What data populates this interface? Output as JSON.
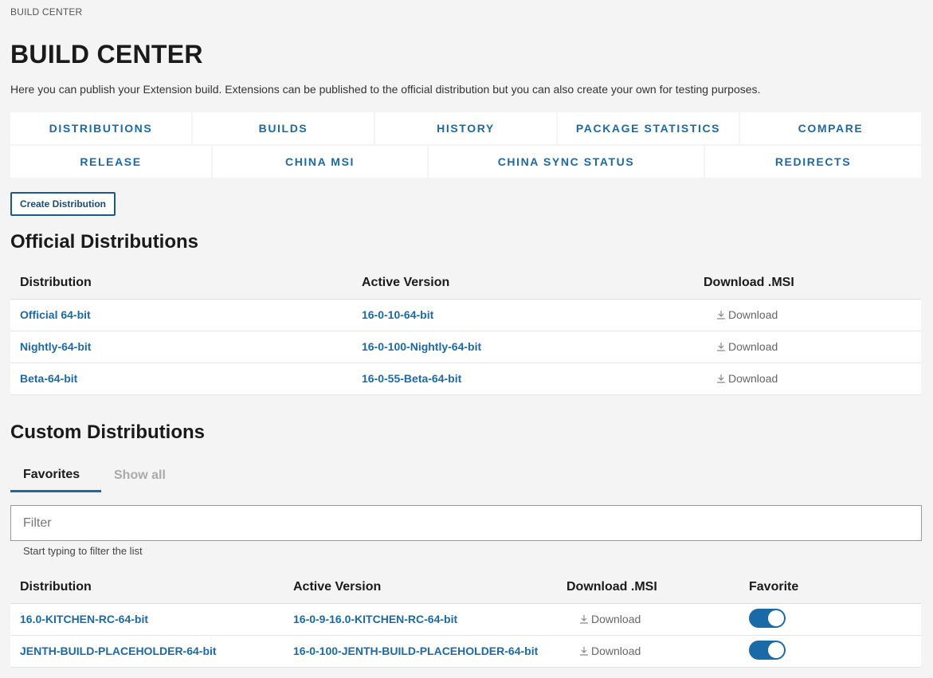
{
  "breadcrumb": "BUILD CENTER",
  "title": "BUILD CENTER",
  "intro": "Here you can publish your Extension build. Extensions can be published to the official distribution but you can also create your own for testing purposes.",
  "nav_row1": [
    "DISTRIBUTIONS",
    "BUILDS",
    "HISTORY",
    "PACKAGE STATISTICS",
    "COMPARE"
  ],
  "nav_row2": [
    "RELEASE",
    "CHINA MSI",
    "CHINA SYNC STATUS",
    "REDIRECTS"
  ],
  "create_button": "Create Distribution",
  "official": {
    "title": "Official Distributions",
    "headers": [
      "Distribution",
      "Active Version",
      "Download .MSI"
    ],
    "rows": [
      {
        "distribution": "Official 64-bit",
        "version": "16-0-10-64-bit",
        "download": "Download"
      },
      {
        "distribution": "Nightly-64-bit",
        "version": "16-0-100-Nightly-64-bit",
        "download": "Download"
      },
      {
        "distribution": "Beta-64-bit",
        "version": "16-0-55-Beta-64-bit",
        "download": "Download"
      }
    ]
  },
  "custom": {
    "title": "Custom Distributions",
    "tabs": [
      "Favorites",
      "Show all"
    ],
    "filter_placeholder": "Filter",
    "filter_help": "Start typing to filter the list",
    "headers": [
      "Distribution",
      "Active Version",
      "Download .MSI",
      "Favorite"
    ],
    "rows": [
      {
        "distribution": "16.0-KITCHEN-RC-64-bit",
        "version": "16-0-9-16.0-KITCHEN-RC-64-bit",
        "download": "Download",
        "favorite": true
      },
      {
        "distribution": "JENTH-BUILD-PLACEHOLDER-64-bit",
        "version": "16-0-100-JENTH-BUILD-PLACEHOLDER-64-bit",
        "download": "Download",
        "favorite": true
      }
    ]
  },
  "colors": {
    "accent": "#1a6aa8",
    "background": "#f4f4f4"
  }
}
